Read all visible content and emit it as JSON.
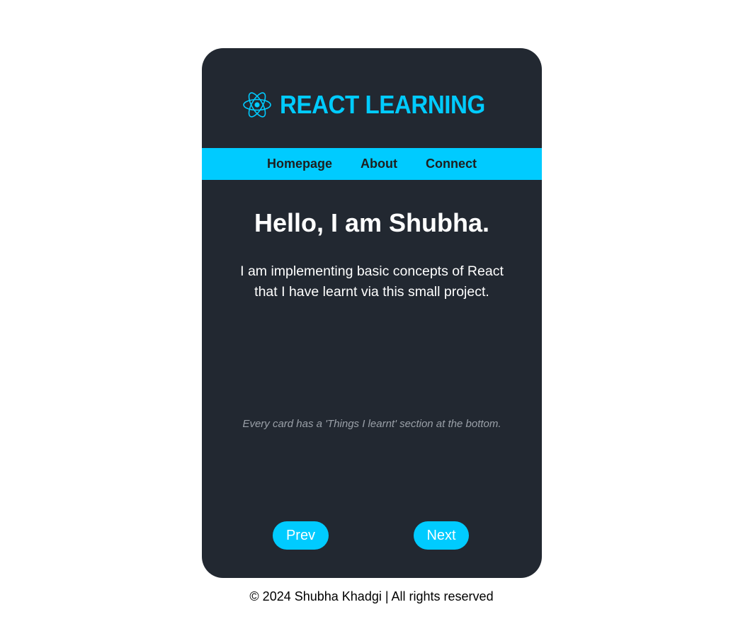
{
  "header": {
    "logo_icon": "react-atom-icon",
    "brand_text": "REACT LEARNING"
  },
  "nav": {
    "items": [
      {
        "label": "Homepage"
      },
      {
        "label": "About"
      },
      {
        "label": "Connect"
      }
    ]
  },
  "main": {
    "greeting": "Hello, I am Shubha.",
    "intro": "I am implementing basic concepts of React that I have learnt via this small project.",
    "note": "Every card has a 'Things I learnt' section at the bottom."
  },
  "controls": {
    "prev_label": "Prev",
    "next_label": "Next"
  },
  "footer": {
    "text": "© 2024 Shubha Khadgi | All rights reserved"
  },
  "colors": {
    "accent": "#00cbff",
    "card_background": "#222831",
    "page_background": "#ffffff"
  }
}
